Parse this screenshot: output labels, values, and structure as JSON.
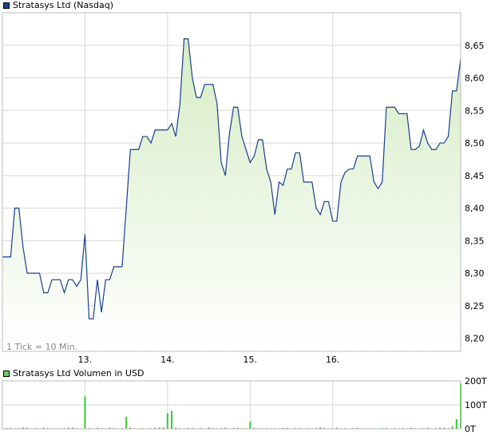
{
  "chart_data": [
    {
      "type": "area",
      "legend": "Stratasys Ltd (Nasdaq)",
      "note": "1 Tick = 10 Min.",
      "x_ticks": [
        "13.",
        "14.",
        "15.",
        "16."
      ],
      "x_tick_index": [
        20,
        40,
        60,
        80
      ],
      "ylim": [
        8.18,
        8.7
      ],
      "y_ticks": [
        "8,20",
        "8,25",
        "8,30",
        "8,35",
        "8,40",
        "8,45",
        "8,50",
        "8,55",
        "8,60",
        "8,65"
      ],
      "y_tick_values": [
        8.2,
        8.25,
        8.3,
        8.35,
        8.4,
        8.45,
        8.5,
        8.55,
        8.6,
        8.65
      ],
      "grid": true,
      "colors": {
        "line": "#1a3f8f",
        "fill_top": "#d6ecc5",
        "fill_bottom": "#ffffff",
        "grid": "#d8d8d8",
        "legend_swatch": "#1a3f8f"
      },
      "values": [
        8.325,
        8.325,
        8.325,
        8.4,
        8.4,
        8.34,
        8.3,
        8.3,
        8.3,
        8.3,
        8.27,
        8.27,
        8.29,
        8.29,
        8.29,
        8.27,
        8.29,
        8.29,
        8.28,
        8.29,
        8.36,
        8.23,
        8.23,
        8.29,
        8.24,
        8.29,
        8.29,
        8.31,
        8.31,
        8.31,
        8.4,
        8.49,
        8.49,
        8.49,
        8.51,
        8.51,
        8.5,
        8.52,
        8.52,
        8.52,
        8.52,
        8.53,
        8.51,
        8.56,
        8.66,
        8.66,
        8.6,
        8.57,
        8.57,
        8.59,
        8.59,
        8.59,
        8.56,
        8.47,
        8.45,
        8.515,
        8.555,
        8.555,
        8.51,
        8.49,
        8.47,
        8.48,
        8.505,
        8.505,
        8.46,
        8.44,
        8.39,
        8.44,
        8.435,
        8.46,
        8.46,
        8.485,
        8.485,
        8.44,
        8.44,
        8.44,
        8.4,
        8.39,
        8.41,
        8.41,
        8.38,
        8.38,
        8.44,
        8.455,
        8.46,
        8.46,
        8.48,
        8.48,
        8.48,
        8.48,
        8.44,
        8.43,
        8.44,
        8.555,
        8.555,
        8.555,
        8.545,
        8.545,
        8.545,
        8.49,
        8.49,
        8.495,
        8.52,
        8.5,
        8.49,
        8.49,
        8.5,
        8.5,
        8.51,
        8.58,
        8.58,
        8.63
      ]
    },
    {
      "type": "bar",
      "legend": "Stratasys Ltd Volumen in USD",
      "ylim": [
        0,
        200
      ],
      "y_ticks": [
        "0T",
        "100T",
        "200T"
      ],
      "y_tick_values": [
        0,
        100,
        200
      ],
      "grid": true,
      "colors": {
        "up": "#33cc33",
        "down": "#cc3333",
        "legend_swatch": "#66cc66"
      },
      "values": [
        2,
        3,
        4,
        2,
        3,
        5,
        4,
        2,
        3,
        2,
        4,
        3,
        2,
        3,
        2,
        3,
        4,
        5,
        3,
        2,
        135,
        3,
        2,
        4,
        3,
        2,
        5,
        3,
        2,
        3,
        50,
        4,
        3,
        2,
        3,
        2,
        3,
        4,
        6,
        5,
        65,
        75,
        4,
        3,
        2,
        4,
        3,
        2,
        3,
        2,
        5,
        3,
        2,
        3,
        4,
        2,
        3,
        4,
        2,
        3,
        30,
        4,
        3,
        2,
        3,
        2,
        3,
        2,
        4,
        3,
        2,
        3,
        4,
        2,
        3,
        2,
        3,
        5,
        4,
        2,
        3,
        4,
        2,
        3,
        2,
        3,
        4,
        2,
        3,
        2,
        3,
        2,
        4,
        3,
        2,
        3,
        2,
        3,
        2,
        4,
        3,
        2,
        3,
        4,
        2,
        3,
        5,
        4,
        3,
        10,
        40,
        190
      ],
      "directions": [
        "u",
        "d",
        "u",
        "d",
        "u",
        "d",
        "d",
        "u",
        "d",
        "u",
        "d",
        "u",
        "d",
        "u",
        "d",
        "u",
        "d",
        "u",
        "d",
        "u",
        "u",
        "d",
        "u",
        "d",
        "u",
        "d",
        "u",
        "d",
        "u",
        "d",
        "u",
        "d",
        "u",
        "d",
        "u",
        "d",
        "u",
        "d",
        "u",
        "d",
        "u",
        "u",
        "d",
        "u",
        "d",
        "u",
        "d",
        "u",
        "d",
        "u",
        "d",
        "u",
        "d",
        "u",
        "d",
        "u",
        "d",
        "u",
        "d",
        "u",
        "u",
        "d",
        "u",
        "d",
        "u",
        "d",
        "u",
        "d",
        "u",
        "d",
        "u",
        "d",
        "u",
        "d",
        "u",
        "d",
        "u",
        "d",
        "u",
        "d",
        "u",
        "d",
        "u",
        "d",
        "u",
        "d",
        "u",
        "d",
        "u",
        "d",
        "u",
        "d",
        "u",
        "d",
        "u",
        "d",
        "u",
        "d",
        "u",
        "d",
        "u",
        "d",
        "u",
        "d",
        "u",
        "d",
        "u",
        "d",
        "u",
        "u",
        "u",
        "u"
      ]
    }
  ]
}
